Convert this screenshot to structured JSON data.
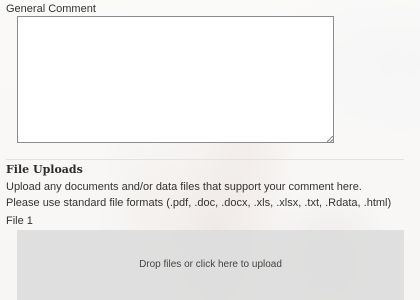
{
  "comment": {
    "label": "General Comment",
    "value": ""
  },
  "uploads": {
    "title": "File Uploads",
    "description": "Upload any documents and/or data files that support your comment here. Please use standard file formats (.pdf, .doc, .docx, .xls, .xlsx, .txt, .Rdata, .html)",
    "file_label": "File 1",
    "dropzone_text": "Drop files or click here to upload"
  }
}
